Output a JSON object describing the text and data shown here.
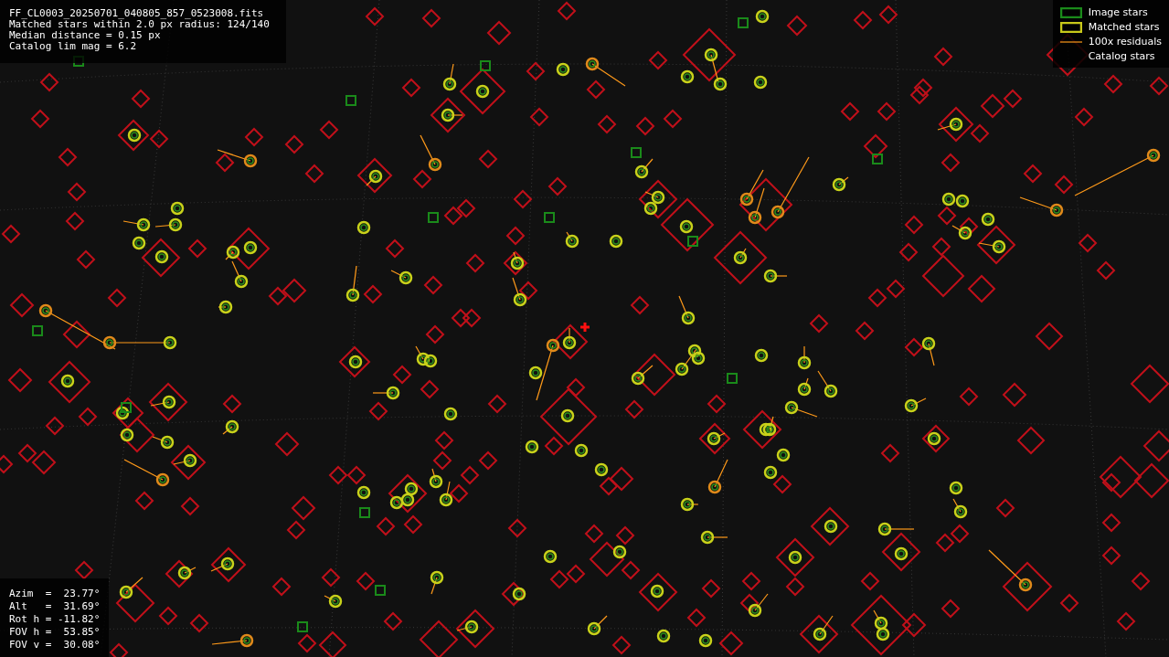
{
  "info_box": {
    "lines": [
      "FF_CL0003_20250701_040805_857_0523008.fits",
      "Matched stars within 2.0 px radius: 124/140",
      "Median distance = 0.15 px",
      "Catalog lim mag = 6.2"
    ]
  },
  "legend": {
    "items": [
      {
        "kind": "image",
        "label": "Image stars"
      },
      {
        "kind": "matched",
        "label": "Matched stars"
      },
      {
        "kind": "residual",
        "label": "100x residuals"
      },
      {
        "kind": "catalog",
        "label": "Catalog stars"
      }
    ]
  },
  "pointing": {
    "lines": [
      "Azim  =  23.77°",
      "Alt   =  31.69°",
      "Rot h = -11.82°",
      "FOV h =  53.85°",
      "FOV v =  30.08°"
    ]
  }
}
